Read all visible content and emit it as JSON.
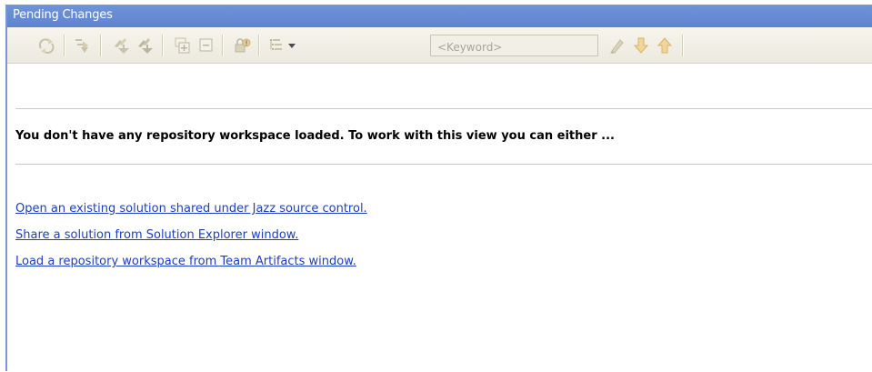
{
  "window": {
    "title": "Pending Changes"
  },
  "toolbar": {
    "keyword_placeholder": "<Keyword>",
    "icons": [
      "refresh-icon",
      "collapse-icon",
      "check-in-icon",
      "deliver-icon",
      "expand-all-icon",
      "collapse-all-icon",
      "lock-icon",
      "view-options-icon",
      "dropdown-arrow-icon",
      "highlight-icon",
      "next-down-icon",
      "previous-up-icon"
    ]
  },
  "main": {
    "message": "You don't have any repository workspace loaded. To work with this view you can either ...",
    "links": [
      "Open an existing solution shared under Jazz source control.",
      "Share a solution from Solution Explorer window.",
      "Load a repository workspace from Team Artifacts window."
    ]
  },
  "colors": {
    "titlebar": "#6f93d8",
    "link": "#1a3fc7",
    "toolbar": "#eceadf",
    "icon_disabled": "#b9b59f"
  }
}
